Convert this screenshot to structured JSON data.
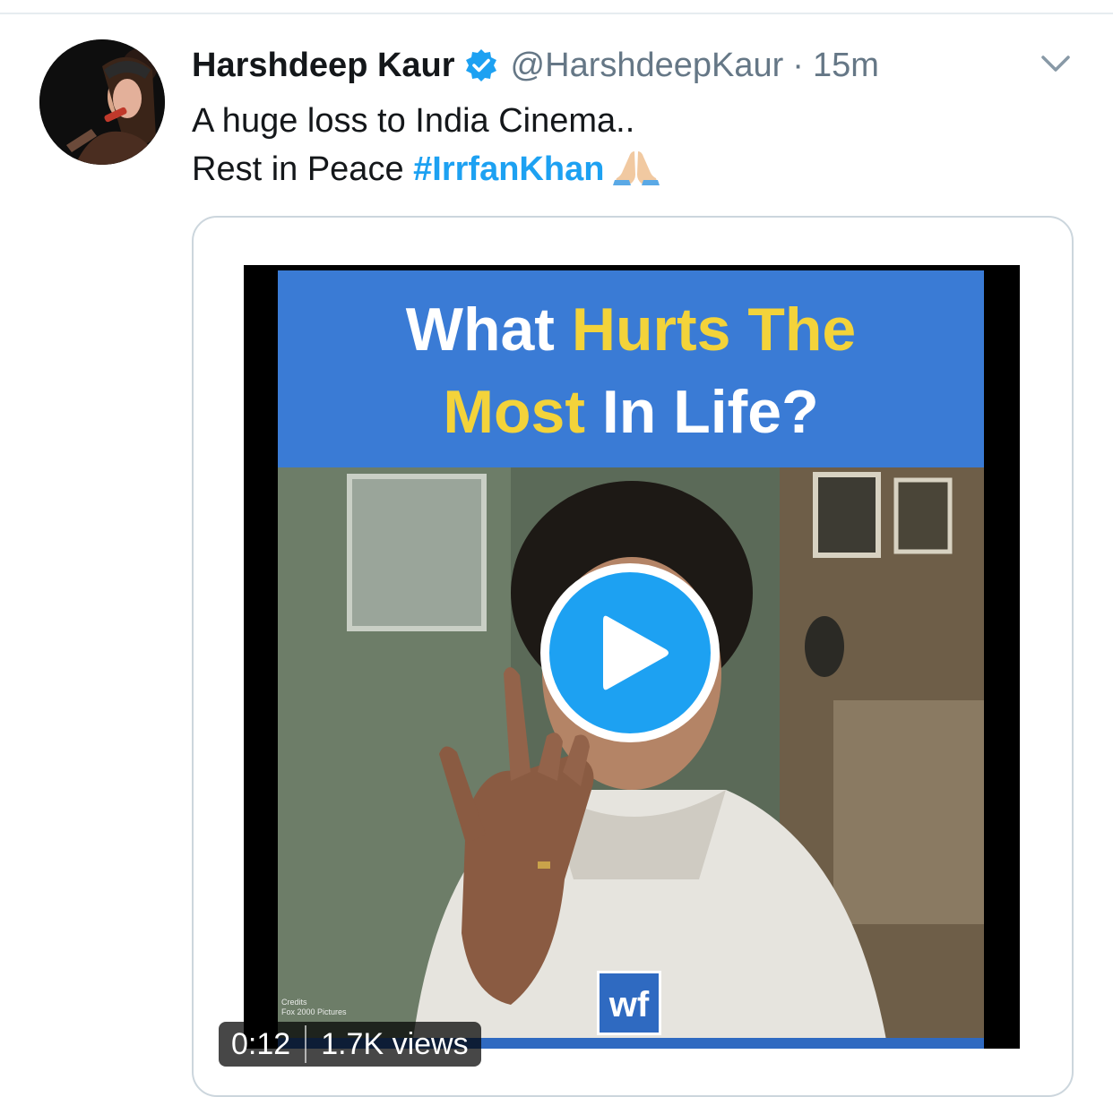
{
  "tweet": {
    "display_name": "Harshdeep Kaur",
    "verified": true,
    "handle": "@HarshdeepKaur",
    "separator": "·",
    "time": "15m",
    "text_line1": "A huge loss to India Cinema..",
    "text_line2_prefix": "Rest in Peace ",
    "hashtag": "#IrrfanKhan",
    "emoji": "folded-hands-emoji"
  },
  "video": {
    "banner_word1": "What",
    "banner_word2": "Hurts The",
    "banner_word3": "Most",
    "banner_word4": "In Life?",
    "logo_text": "wf",
    "credits_line1": "Credits",
    "credits_line2": "Fox 2000 Pictures",
    "duration": "0:12",
    "views": "1.7K views"
  },
  "colors": {
    "link_blue": "#1da1f2",
    "banner_blue": "#3a7bd5",
    "banner_yellow": "#f3d33a",
    "text_primary": "#14171a",
    "text_secondary": "#657786"
  }
}
